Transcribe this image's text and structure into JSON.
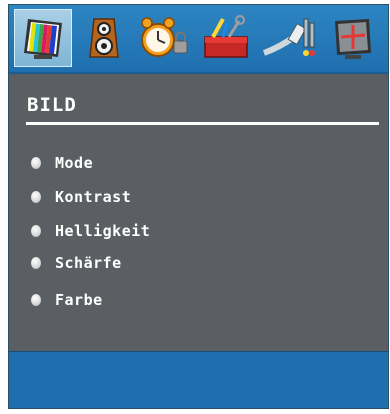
{
  "tabs": [
    {
      "name": "picture",
      "icon": "tv-picture-icon",
      "selected": true
    },
    {
      "name": "sound",
      "icon": "speaker-icon",
      "selected": false
    },
    {
      "name": "timers",
      "icon": "alarm-clock-icon",
      "selected": false
    },
    {
      "name": "install",
      "icon": "toolbox-icon",
      "selected": false
    },
    {
      "name": "source",
      "icon": "av-cables-icon",
      "selected": false
    },
    {
      "name": "screen",
      "icon": "screen-position-icon",
      "selected": false
    }
  ],
  "panel": {
    "title": "BILD",
    "items": [
      {
        "label": "Mode"
      },
      {
        "label": "Kontrast"
      },
      {
        "label": "Helligkeit"
      },
      {
        "label": "Schärfe"
      },
      {
        "label": "Farbe"
      }
    ]
  },
  "colors": {
    "tabbar": "#2d85c2",
    "panel": "#5b5f63",
    "footer": "#1f6fae",
    "text": "#ffffff"
  }
}
